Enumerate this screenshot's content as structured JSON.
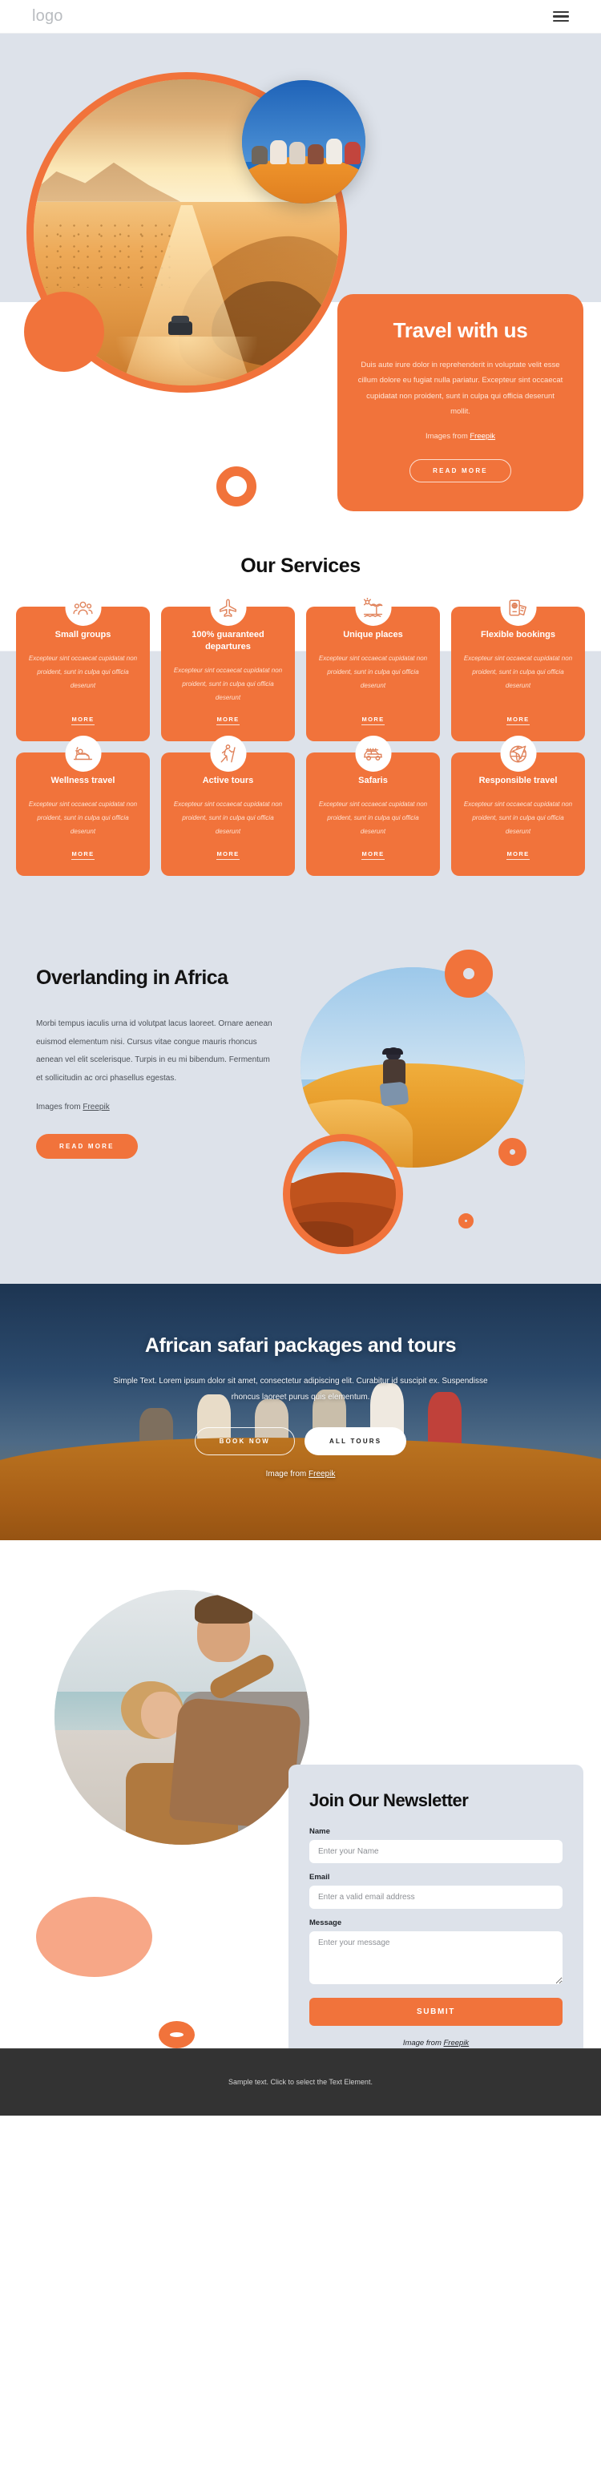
{
  "header": {
    "logo": "logo",
    "menu_icon": "hamburger-menu-icon"
  },
  "hero": {
    "title": "Travel with us",
    "paragraph": "Duis aute irure dolor in reprehenderit in voluptate velit esse cillum dolore eu fugiat nulla pariatur. Excepteur sint occaecat cupidatat non proident, sunt in culpa qui officia deserunt mollit.",
    "credit_prefix": "Images from ",
    "credit_link": "Freepik",
    "cta": "READ MORE"
  },
  "services": {
    "title": "Our Services",
    "more_label": "MORE",
    "body": "Excepteur sint occaecat cupidatat non proident, sunt in culpa qui officia deserunt",
    "items": [
      {
        "name": "Small groups",
        "icon": "people-group-icon"
      },
      {
        "name": "100% guaranteed departures",
        "icon": "airplane-icon"
      },
      {
        "name": "Unique places",
        "icon": "palm-beach-icon"
      },
      {
        "name": "Flexible bookings",
        "icon": "passport-ticket-icon"
      },
      {
        "name": "Wellness travel",
        "icon": "spa-massage-icon"
      },
      {
        "name": "Active tours",
        "icon": "hiker-icon"
      },
      {
        "name": "Safaris",
        "icon": "safari-jeep-icon"
      },
      {
        "name": "Responsible travel",
        "icon": "globe-plane-icon"
      }
    ]
  },
  "overlanding": {
    "title": "Overlanding in Africa",
    "paragraph": "Morbi tempus iaculis urna id volutpat lacus laoreet. Ornare aenean euismod elementum nisi. Cursus vitae congue mauris rhoncus aenean vel elit scelerisque. Turpis in eu mi bibendum. Fermentum et sollicitudin ac orci phasellus egestas.",
    "credit_prefix": "Images from ",
    "credit_link": "Freepik",
    "cta": "READ MORE"
  },
  "safari": {
    "title": "African safari packages and tours",
    "paragraph": "Simple Text. Lorem ipsum dolor sit amet, consectetur adipiscing elit. Curabitur id suscipit ex. Suspendisse rhoncus laoreet purus quis elementum.",
    "primary_cta": "BOOK NOW",
    "secondary_cta": "ALL TOURS",
    "credit_prefix": "Image from ",
    "credit_link": "Freepik"
  },
  "newsletter": {
    "title": "Join Our Newsletter",
    "name_label": "Name",
    "name_placeholder": "Enter your Name",
    "email_label": "Email",
    "email_placeholder": "Enter a valid email address",
    "message_label": "Message",
    "message_placeholder": "Enter your message",
    "submit": "SUBMIT",
    "credit_prefix": "Image from ",
    "credit_link": "Freepik"
  },
  "footer": {
    "text": "Sample text. Click to select the Text Element."
  },
  "colors": {
    "accent": "#F1733B",
    "accent_light": "#F7A787",
    "surface": "#DDE2EA",
    "footer_bg": "#333333"
  }
}
